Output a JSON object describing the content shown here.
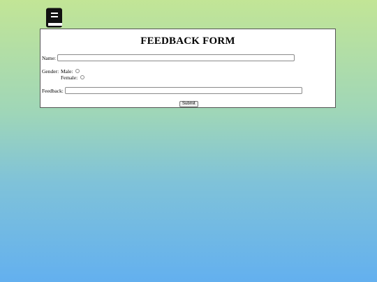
{
  "form": {
    "title": "FEEDBACK FORM",
    "name_label": "Name:",
    "name_value": "",
    "gender_label": "Gender:",
    "male_label": "Male:",
    "female_label": "Female:",
    "male_checked": false,
    "female_checked": false,
    "feedback_label": "Feedback:",
    "feedback_value": "",
    "submit_label": "Submit"
  },
  "icons": {
    "header_icon": "book-icon"
  },
  "colors": {
    "gradient_top": "#c2e596",
    "gradient_bottom": "#63b0ef",
    "icon": "#111111"
  }
}
